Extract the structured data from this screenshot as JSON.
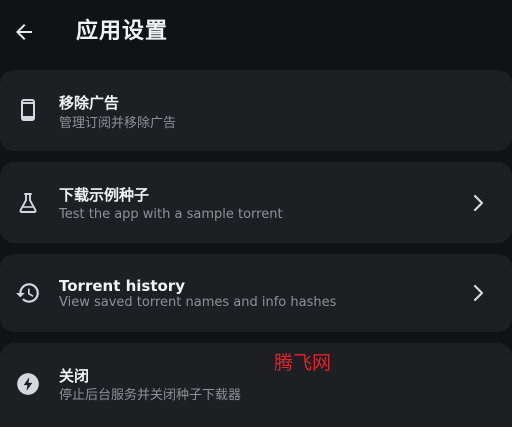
{
  "header": {
    "title": "应用设置",
    "back_icon": "arrow-left-icon"
  },
  "settings": [
    {
      "title": "移除广告",
      "subtitle": "管理订阅并移除广告",
      "icon": "phone-icon",
      "has_chevron": false
    },
    {
      "title": "下载示例种子",
      "subtitle": "Test the app with a sample torrent",
      "icon": "flask-icon",
      "has_chevron": true
    },
    {
      "title": "Torrent history",
      "subtitle": "View saved torrent names and info hashes",
      "icon": "history-icon",
      "has_chevron": true
    },
    {
      "title": "关闭",
      "subtitle": "停止后台服务并关闭种子下载器",
      "icon": "bolt-icon",
      "has_chevron": false
    }
  ],
  "watermark": "腾飞网",
  "colors": {
    "background": "#111214",
    "card": "#1d1f23",
    "title_text": "#f1f2f5",
    "subtitle_text": "#8e9198",
    "watermark": "#e0222a"
  }
}
